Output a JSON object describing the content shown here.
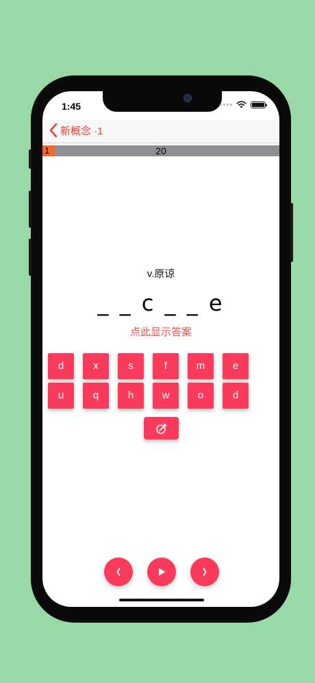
{
  "status_bar": {
    "time": "1:45"
  },
  "nav": {
    "back_label": "新概念 ·1"
  },
  "progress": {
    "current": "1",
    "total": "20",
    "fraction": 0.05
  },
  "quiz": {
    "definition": "v.原谅",
    "masked_word": "_ _ c _ _ e",
    "show_answer_label": "点此显示答案"
  },
  "keyboard": {
    "row1": [
      "d",
      "x",
      "s",
      "f",
      "m",
      "e"
    ],
    "row2": [
      "u",
      "q",
      "h",
      "w",
      "o",
      "d"
    ],
    "clear_icon": "eraser-icon"
  },
  "controls": {
    "prev_icon": "chevron-left-icon",
    "play_icon": "play-icon",
    "next_icon": "chevron-right-icon"
  },
  "colors": {
    "accent": "#fb3b5c",
    "nav_tint": "#e94235",
    "progress_fill": "#f46a2c",
    "progress_track": "#8e8e93",
    "background": "#99d9a8"
  }
}
